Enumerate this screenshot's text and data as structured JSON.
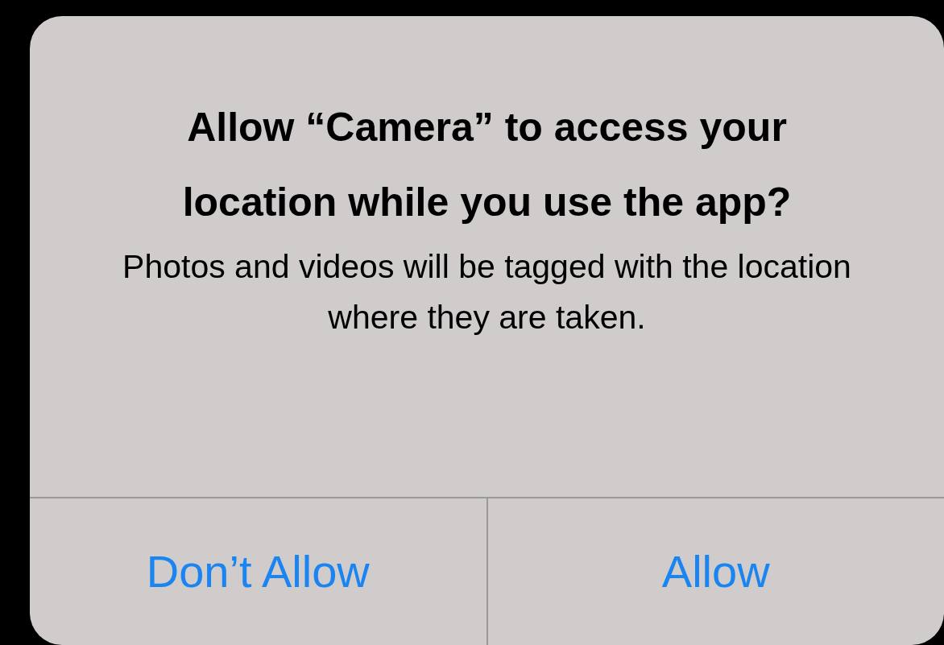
{
  "alert": {
    "title": "Allow “Camera” to access your location while you use the app?",
    "message": "Photos and videos will be tagged with the location where they are taken.",
    "buttons": [
      {
        "label": "Don’t Allow"
      },
      {
        "label": "Allow"
      }
    ]
  }
}
